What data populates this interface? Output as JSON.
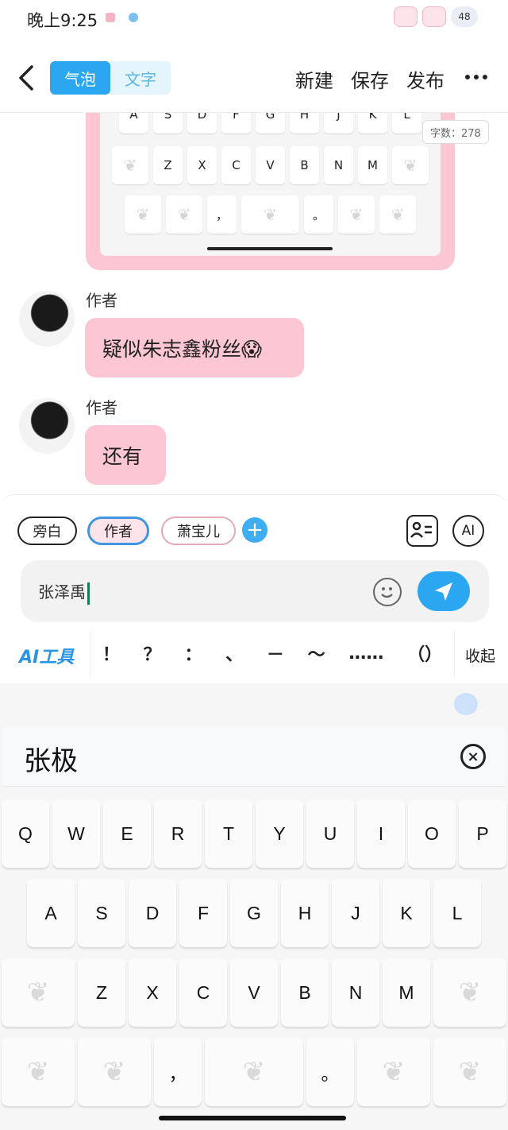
{
  "status": {
    "time": "晚上9:25",
    "battery": "48"
  },
  "topbar": {
    "tabs": [
      {
        "label": "气泡"
      },
      {
        "label": "文字"
      }
    ],
    "actions": [
      {
        "label": "新建"
      },
      {
        "label": "保存"
      },
      {
        "label": "发布"
      }
    ]
  },
  "preview": {
    "word_count": "字数：278",
    "rows": [
      [
        "A",
        "S",
        "D",
        "F",
        "G",
        "H",
        "J",
        "K",
        "L"
      ],
      [
        "Z",
        "X",
        "C",
        "V",
        "B",
        "N",
        "M"
      ],
      [
        "，",
        "。"
      ]
    ]
  },
  "messages": [
    {
      "author": "作者",
      "text": "疑似朱志鑫粉丝😱"
    },
    {
      "author": "作者",
      "text": "还有"
    }
  ],
  "composer": {
    "chips": [
      {
        "label": "旁白"
      },
      {
        "label": "作者"
      },
      {
        "label": "萧宝儿"
      }
    ],
    "ai_label": "AI",
    "input_value": "张泽禹",
    "ai_tools_label": "AI工具",
    "punctuation": [
      "！",
      "？",
      "：",
      "、",
      "－",
      "～",
      "……",
      "（）"
    ],
    "collapse_label": "收起"
  },
  "ime": {
    "candidate": "张极",
    "rows": [
      [
        "Q",
        "W",
        "E",
        "R",
        "T",
        "Y",
        "U",
        "I",
        "O",
        "P"
      ],
      [
        "A",
        "S",
        "D",
        "F",
        "G",
        "H",
        "J",
        "K",
        "L"
      ],
      [
        "Z",
        "X",
        "C",
        "V",
        "B",
        "N",
        "M"
      ],
      [
        "，",
        "。"
      ]
    ]
  },
  "colors": {
    "accent": "#2ba7f2",
    "bubble": "#fcc6d2"
  }
}
